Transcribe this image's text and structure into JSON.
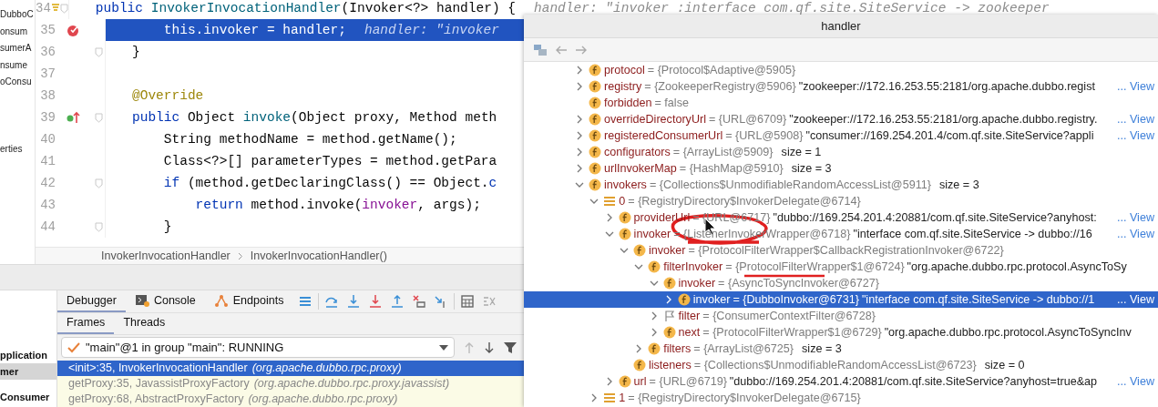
{
  "project_tree": [
    {
      "label": "DubboC"
    },
    {
      "label": "onsum"
    },
    {
      "label": "sumerA"
    },
    {
      "label": "nsume"
    },
    {
      "label": "oConsu"
    },
    {
      "label": "erties"
    }
  ],
  "editor": {
    "lines": [
      {
        "number": "34",
        "kind": "bookmark",
        "fold": true,
        "selected": false,
        "tokens": [
          {
            "kind": "keyword",
            "text": "public "
          },
          {
            "kind": "method",
            "text": "InvokerInvocationHandler"
          },
          {
            "kind": "plain",
            "text": "(Invoker<?> handler) {"
          },
          {
            "kind": "hint",
            "text": "handler: \"invoker :interface com.qf.site.SiteService -> zookeeper"
          }
        ]
      },
      {
        "number": "35",
        "kind": "breakpoint",
        "fold": false,
        "selected": true,
        "tokens": [
          {
            "kind": "plain",
            "text": "    this.invoker = handler;"
          },
          {
            "kind": "hint",
            "text": "handler: \"invoker"
          }
        ]
      },
      {
        "number": "36",
        "kind": "plain",
        "fold": true,
        "selected": false,
        "tokens": [
          {
            "kind": "plain",
            "text": "}"
          }
        ]
      },
      {
        "number": "37",
        "kind": "plain",
        "fold": false,
        "selected": false
      },
      {
        "number": "38",
        "kind": "plain",
        "fold": false,
        "selected": false,
        "tokens": [
          {
            "kind": "annotation",
            "text": "@Override"
          }
        ]
      },
      {
        "number": "39",
        "kind": "override",
        "fold": true,
        "selected": false,
        "tokens": [
          {
            "kind": "keyword",
            "text": "public "
          },
          {
            "kind": "plain",
            "text": "Object "
          },
          {
            "kind": "method",
            "text": "invoke"
          },
          {
            "kind": "plain",
            "text": "(Object proxy, Method meth"
          }
        ]
      },
      {
        "number": "40",
        "kind": "plain",
        "fold": false,
        "selected": false,
        "tokens": [
          {
            "kind": "plain",
            "text": "    String methodName = method.getName();"
          }
        ]
      },
      {
        "number": "41",
        "kind": "plain",
        "fold": false,
        "selected": false,
        "tokens": [
          {
            "kind": "plain",
            "text": "    Class<?>[] parameterTypes = method.getPara"
          }
        ]
      },
      {
        "number": "42",
        "kind": "plain",
        "fold": true,
        "selected": false,
        "tokens": [
          {
            "kind": "keyword",
            "text": "    if "
          },
          {
            "kind": "plain",
            "text": "(method.getDeclaringClass() == Object."
          },
          {
            "kind": "keyword",
            "text": "c"
          }
        ]
      },
      {
        "number": "43",
        "kind": "plain",
        "fold": false,
        "selected": false,
        "tokens": [
          {
            "kind": "keyword",
            "text": "        return "
          },
          {
            "kind": "plain",
            "text": "method.invoke("
          },
          {
            "kind": "field",
            "text": "invoker"
          },
          {
            "kind": "plain",
            "text": ", args);"
          }
        ]
      },
      {
        "number": "44",
        "kind": "plain",
        "fold": true,
        "selected": false,
        "tokens": [
          {
            "kind": "plain",
            "text": "    }"
          }
        ]
      }
    ],
    "breadcrumbs": [
      "InvokerInvocationHandler",
      "InvokerInvocationHandler()"
    ]
  },
  "services_tree": [
    {
      "label": "pplication",
      "selected": false
    },
    {
      "label": "mer",
      "selected": true
    },
    {
      "label": "Consumer",
      "selected": false
    }
  ],
  "debugger": {
    "tabs": [
      {
        "label": "Debugger",
        "selected": true
      },
      {
        "label": "Console",
        "selected": false
      },
      {
        "label": "Endpoints",
        "selected": false
      }
    ],
    "subtabs": [
      {
        "label": "Frames",
        "selected": true
      },
      {
        "label": "Threads",
        "selected": false
      }
    ],
    "thread": "\"main\"@1 in group \"main\": RUNNING",
    "frames": [
      {
        "method": "<init>:35, InvokerInvocationHandler",
        "package": "(org.apache.dubbo.rpc.proxy)",
        "selected": true
      },
      {
        "method": "getProxy:35, JavassistProxyFactory",
        "package": "(org.apache.dubbo.rpc.proxy.javassist)",
        "selected": false
      },
      {
        "method": "getProxy:68, AbstractProxyFactory",
        "package": "(org.apache.dubbo.rpc.proxy)",
        "selected": false
      }
    ]
  },
  "popup": {
    "title": "handler",
    "tree": [
      {
        "kind": "field",
        "expandable": true,
        "expanded": false,
        "name": "protocol",
        "ref": "= {Protocol$Adaptive@5905}"
      },
      {
        "kind": "field",
        "expandable": true,
        "expanded": false,
        "name": "registry",
        "ref": "= {ZookeeperRegistry@5906}",
        "detail": "\"zookeeper://172.16.253.55:2181/org.apache.dubbo.regist",
        "link": "... View"
      },
      {
        "kind": "field",
        "expandable": false,
        "name": "forbidden",
        "ref": "= false"
      },
      {
        "kind": "field",
        "expandable": true,
        "expanded": false,
        "name": "overrideDirectoryUrl",
        "ref": "= {URL@6709}",
        "detail": "\"zookeeper://172.16.253.55:2181/org.apache.dubbo.registry.",
        "link": "... View"
      },
      {
        "kind": "field",
        "expandable": true,
        "expanded": false,
        "name": "registeredConsumerUrl",
        "ref": "= {URL@5908}",
        "detail": "\"consumer://169.254.201.4/com.qf.site.SiteService?appli",
        "link": "... View"
      },
      {
        "kind": "field",
        "expandable": true,
        "expanded": false,
        "name": "configurators",
        "ref": "= {ArrayList@5909}",
        "size": "size = 1"
      },
      {
        "kind": "field",
        "expandable": true,
        "expanded": false,
        "name": "urlInvokerMap",
        "ref": "= {HashMap@5910}",
        "size": "size = 3"
      },
      {
        "kind": "field",
        "expandable": true,
        "expanded": true,
        "name": "invokers",
        "ref": "= {Collections$UnmodifiableRandomAccessList@5911}",
        "size": "size = 3",
        "children": [
          {
            "kind": "element",
            "expandable": true,
            "expanded": true,
            "name": "0",
            "ref": "= {RegistryDirectory$InvokerDelegate@6714}",
            "children": [
              {
                "kind": "field",
                "expandable": true,
                "expanded": false,
                "name": "providerUrl",
                "ref": "= {URL@6717}",
                "detail": "\"dubbo://169.254.201.4:20881/com.qf.site.SiteService?anyhost:",
                "link": "... View"
              },
              {
                "kind": "field",
                "expandable": true,
                "expanded": true,
                "name": "invoker",
                "ref": "= {ListenerInvokerWrapper@6718}",
                "detail": "\"interface com.qf.site.SiteService -> dubbo://16",
                "link": "... View",
                "children": [
                  {
                    "kind": "field",
                    "expandable": true,
                    "expanded": true,
                    "name": "invoker",
                    "ref": "= {ProtocolFilterWrapper$CallbackRegistrationInvoker@6722}",
                    "children": [
                      {
                        "kind": "field",
                        "expandable": true,
                        "expanded": true,
                        "name": "filterInvoker",
                        "ref": "= {ProtocolFilterWrapper$1@6724}",
                        "detail": "\"org.apache.dubbo.rpc.protocol.AsyncToSy",
                        "children": [
                          {
                            "kind": "field",
                            "expandable": true,
                            "expanded": true,
                            "name": "invoker",
                            "ref": "= {AsyncToSyncInvoker@6727}",
                            "children": [
                              {
                                "kind": "field",
                                "expandable": true,
                                "expanded": false,
                                "selected": true,
                                "name": "invoker",
                                "ref": "= {DubboInvoker@6731}",
                                "detail": "\"interface com.qf.site.SiteService -> dubbo://1",
                                "link": "... View"
                              }
                            ]
                          },
                          {
                            "kind": "flag",
                            "expandable": true,
                            "expanded": false,
                            "name": "filter",
                            "ref": "= {ConsumerContextFilter@6728}"
                          },
                          {
                            "kind": "field",
                            "expandable": true,
                            "expanded": false,
                            "name": "next",
                            "ref": "= {ProtocolFilterWrapper$1@6729}",
                            "detail": "\"org.apache.dubbo.rpc.protocol.AsyncToSyncInv"
                          }
                        ]
                      },
                      {
                        "kind": "field",
                        "expandable": true,
                        "expanded": false,
                        "name": "filters",
                        "ref": "= {ArrayList@6725}",
                        "size": "size = 3"
                      }
                    ]
                  },
                  {
                    "kind": "field",
                    "expandable": false,
                    "name": "listeners",
                    "ref": "= {Collections$UnmodifiableRandomAccessList@6723}",
                    "size": "size = 0"
                  }
                ]
              },
              {
                "kind": "field",
                "expandable": true,
                "expanded": false,
                "name": "url",
                "ref": "= {URL@6719}",
                "detail": "\"dubbo://169.254.201.4:20881/com.qf.site.SiteService?anyhost=true&ap",
                "link": "... View"
              }
            ]
          },
          {
            "kind": "element",
            "expandable": true,
            "expanded": false,
            "name": "1",
            "ref": "= {RegistryDirectory$InvokerDelegate@6715}"
          }
        ]
      }
    ]
  }
}
